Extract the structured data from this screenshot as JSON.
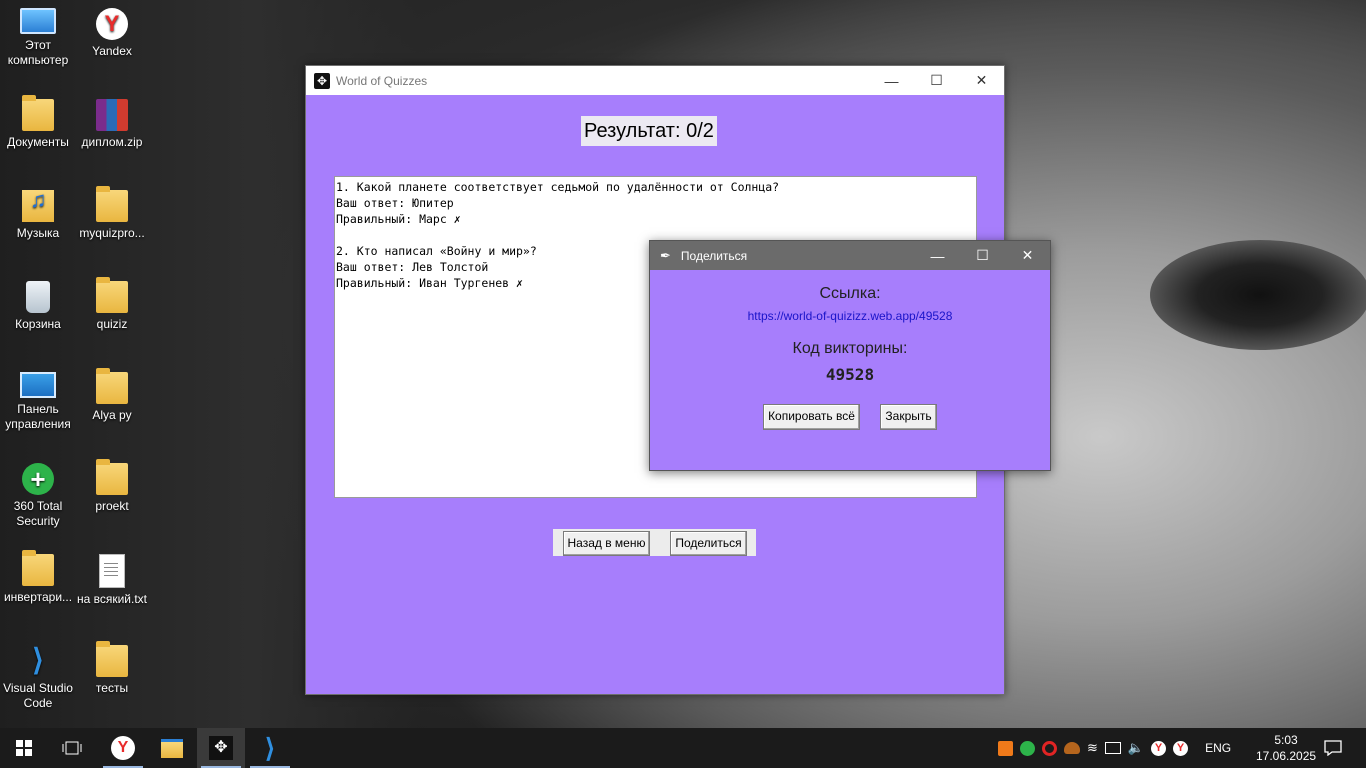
{
  "desktop": {
    "icons": [
      {
        "label": "Этот компьютер",
        "icon": "computer-icon"
      },
      {
        "label": "Yandex",
        "icon": "yandex-browser-icon"
      },
      {
        "label": "Документы",
        "icon": "documents-icon"
      },
      {
        "label": "диплом.zip",
        "icon": "winrar-archive-icon"
      },
      {
        "label": "Музыка",
        "icon": "music-folder-icon"
      },
      {
        "label": "myquizpro...",
        "icon": "folder-icon"
      },
      {
        "label": "Корзина",
        "icon": "recycle-bin-icon"
      },
      {
        "label": "quiziz",
        "icon": "folder-icon"
      },
      {
        "label": "Панель управления",
        "icon": "control-panel-icon"
      },
      {
        "label": "Alya py",
        "icon": "folder-icon"
      },
      {
        "label": "360 Total Security",
        "icon": "360-security-icon"
      },
      {
        "label": "proekt",
        "icon": "folder-icon"
      },
      {
        "label": "инвертари...",
        "icon": "file-icon"
      },
      {
        "label": "на всякий.txt",
        "icon": "text-file-icon"
      },
      {
        "label": "Visual Studio Code",
        "icon": "vscode-icon"
      },
      {
        "label": "тесты",
        "icon": "folder-icon"
      }
    ]
  },
  "main_window": {
    "title": "World of Quizzes",
    "result": "Результат: 0/2",
    "review_lines": [
      "1. Какой планете соответствует седьмой по удалённости от Солнца?",
      "Ваш ответ: Юпитер",
      "Правильный: Марс ✗",
      "",
      "2. Кто написал «Войну и мир»?",
      "Ваш ответ: Лев Толстой",
      "Правильный: Иван Тургенев ✗"
    ],
    "back_button": "Назад в меню",
    "share_button": "Поделиться",
    "bg_color": "#a77efc"
  },
  "share_dialog": {
    "title": "Поделиться",
    "link_label": "Ссылка:",
    "link": "https://world-of-quizizz.web.app/49528",
    "code_label": "Код викторины:",
    "code": "49528",
    "copy_button": "Копировать всё",
    "close_button": "Закрыть"
  },
  "taskbar": {
    "language": "ENG",
    "time": "5:03",
    "date": "17.06.2025"
  }
}
